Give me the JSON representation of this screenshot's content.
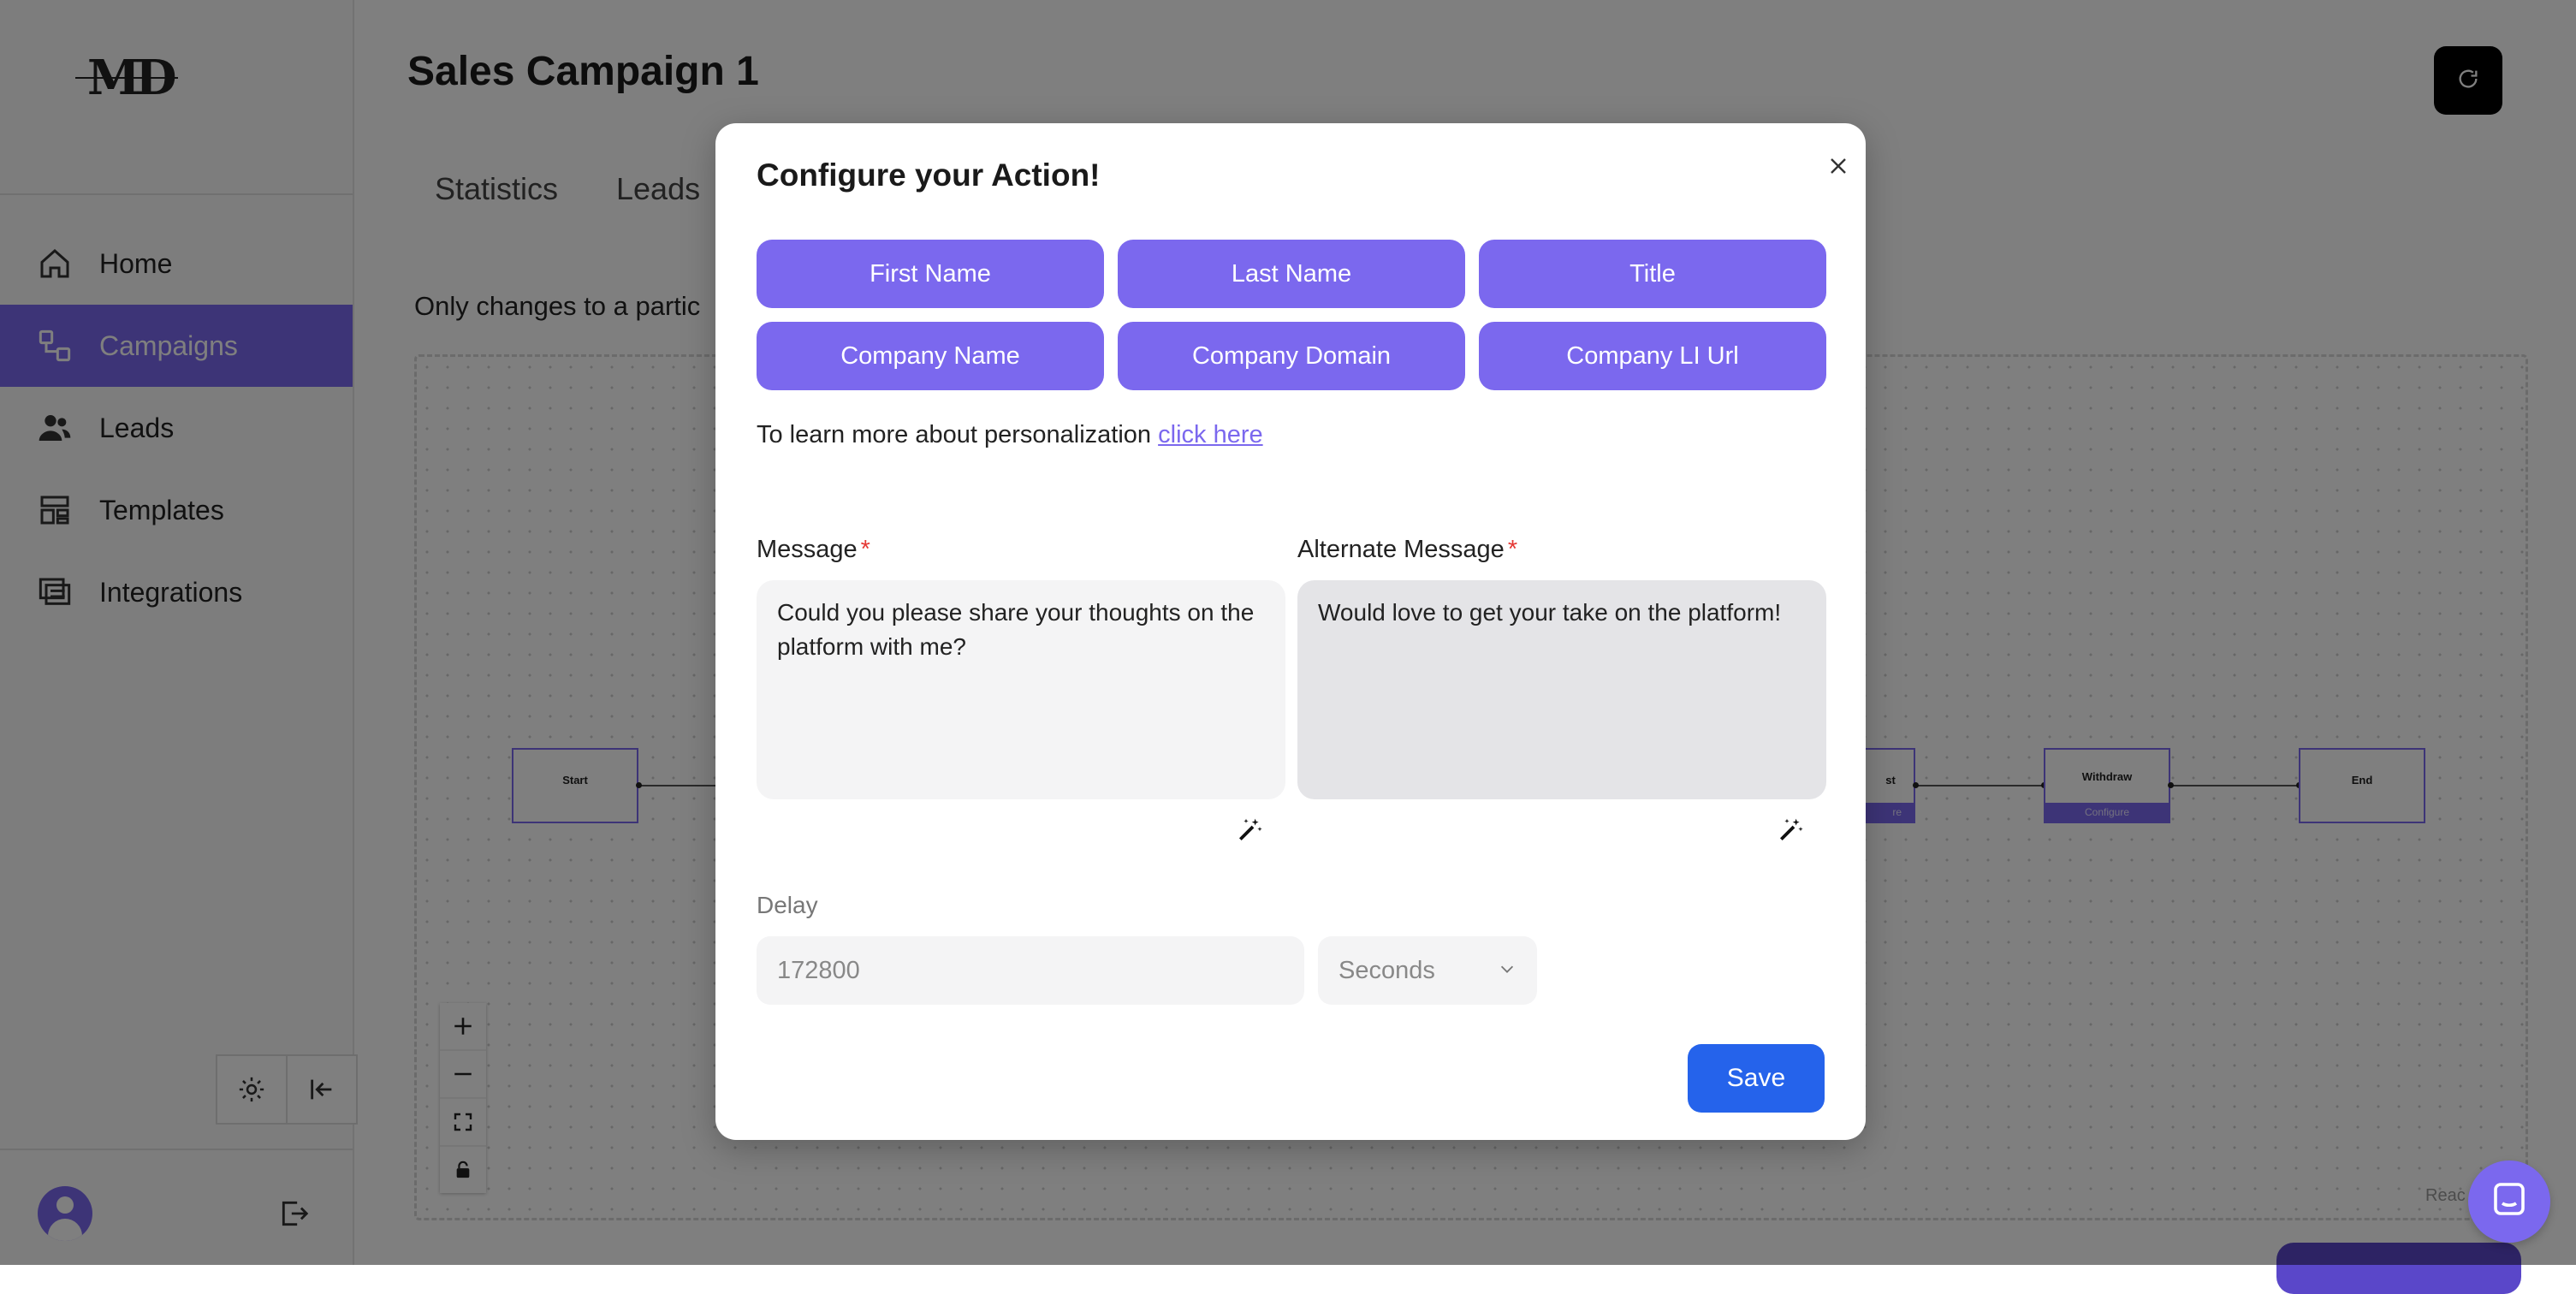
{
  "sidebar": {
    "logo": "MD",
    "items": [
      {
        "label": "Home",
        "icon": "home-icon"
      },
      {
        "label": "Campaigns",
        "icon": "campaigns-icon",
        "active": true
      },
      {
        "label": "Leads",
        "icon": "users-icon"
      },
      {
        "label": "Templates",
        "icon": "templates-icon"
      },
      {
        "label": "Integrations",
        "icon": "integrations-icon"
      }
    ],
    "tools": [
      "gear-icon",
      "collapse-icon"
    ],
    "footer": [
      "avatar",
      "logout-icon"
    ]
  },
  "header": {
    "title": "Sales Campaign 1",
    "refresh_icon": "refresh-icon"
  },
  "tabs": [
    {
      "label": "Statistics"
    },
    {
      "label": "Leads"
    }
  ],
  "notice": "Only changes to a partic",
  "flow": {
    "nodes": [
      {
        "label": "Start",
        "configure": ""
      },
      {
        "label": "st",
        "configure": "re"
      },
      {
        "label": "Withdraw",
        "configure": "Configure"
      },
      {
        "label": "End",
        "configure": ""
      }
    ]
  },
  "canvas_controls": [
    "plus-icon",
    "minus-icon",
    "fit-view-icon",
    "lock-icon"
  ],
  "attribution": "Reac",
  "modal": {
    "title": "Configure your Action!",
    "close_icon": "close-icon",
    "variables": [
      "First Name",
      "Last Name",
      "Title",
      "Company Name",
      "Company Domain",
      "Company LI Url"
    ],
    "learn_text": "To learn more about personalization ",
    "learn_link": "click here",
    "message_label": "Message",
    "message_value": "Could you please share your thoughts on the platform with me?",
    "alt_message_label": "Alternate Message",
    "alt_message_value": "Would love to get your take on the platform!",
    "required_mark": "*",
    "delay_label": "Delay",
    "delay_value": "172800",
    "delay_unit": "Seconds",
    "save_label": "Save"
  },
  "colors": {
    "accent": "#7b68ee",
    "primary_button": "#2563eb",
    "required": "#e53935"
  }
}
